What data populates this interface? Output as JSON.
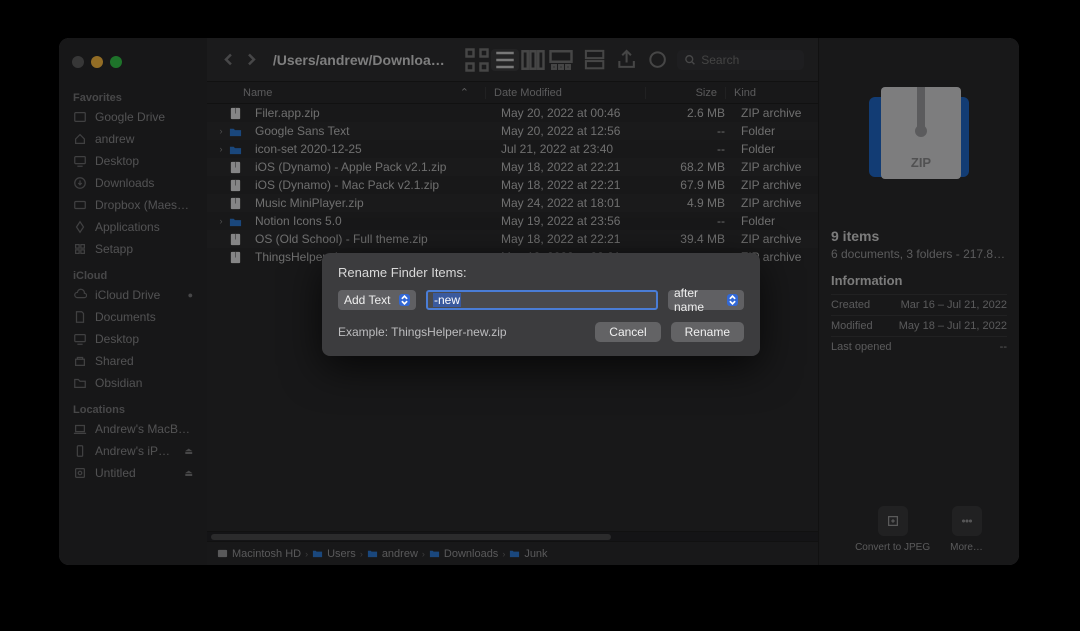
{
  "traffic": {
    "close": "close",
    "min": "minimize",
    "max": "maximize"
  },
  "sidebar": {
    "sections": [
      {
        "heading": "Favorites",
        "items": [
          {
            "label": "Google Drive",
            "icon": "drive"
          },
          {
            "label": "andrew",
            "icon": "home"
          },
          {
            "label": "Desktop",
            "icon": "desktop"
          },
          {
            "label": "Downloads",
            "icon": "downloads"
          },
          {
            "label": "Dropbox (Maes…",
            "icon": "dropbox"
          },
          {
            "label": "Applications",
            "icon": "apps"
          },
          {
            "label": "Setapp",
            "icon": "setapp"
          }
        ]
      },
      {
        "heading": "iCloud",
        "items": [
          {
            "label": "iCloud Drive",
            "icon": "cloud",
            "badge": "●"
          },
          {
            "label": "Documents",
            "icon": "doc"
          },
          {
            "label": "Desktop",
            "icon": "desktop"
          },
          {
            "label": "Shared",
            "icon": "shared"
          },
          {
            "label": "Obsidian",
            "icon": "folder"
          }
        ]
      },
      {
        "heading": "Locations",
        "items": [
          {
            "label": "Andrew's MacB…",
            "icon": "laptop"
          },
          {
            "label": "Andrew's iP…",
            "icon": "phone",
            "badge": "⏏"
          },
          {
            "label": "Untitled",
            "icon": "disk",
            "badge": "⏏"
          }
        ]
      }
    ]
  },
  "toolbar": {
    "path": "/Users/andrew/Downloads/Junk",
    "search_placeholder": "Search"
  },
  "columns": {
    "name": "Name",
    "date": "Date Modified",
    "size": "Size",
    "kind": "Kind",
    "sort": "⌃"
  },
  "files": [
    {
      "name": "Filer.app.zip",
      "date": "May 20, 2022 at 00:46",
      "size": "2.6 MB",
      "kind": "ZIP archive",
      "type": "zip"
    },
    {
      "name": "Google Sans Text",
      "date": "May 20, 2022 at 12:56",
      "size": "--",
      "kind": "Folder",
      "type": "folder",
      "expand": true
    },
    {
      "name": "icon-set 2020-12-25",
      "date": "Jul 21, 2022 at 23:40",
      "size": "--",
      "kind": "Folder",
      "type": "folder",
      "expand": true
    },
    {
      "name": "iOS (Dynamo) - Apple Pack v2.1.zip",
      "date": "May 18, 2022 at 22:21",
      "size": "68.2 MB",
      "kind": "ZIP archive",
      "type": "zip"
    },
    {
      "name": "iOS (Dynamo) - Mac Pack v2.1.zip",
      "date": "May 18, 2022 at 22:21",
      "size": "67.9 MB",
      "kind": "ZIP archive",
      "type": "zip"
    },
    {
      "name": "Music MiniPlayer.zip",
      "date": "May 24, 2022 at 18:01",
      "size": "4.9 MB",
      "kind": "ZIP archive",
      "type": "zip"
    },
    {
      "name": "Notion Icons 5.0",
      "date": "May 19, 2022 at 23:56",
      "size": "--",
      "kind": "Folder",
      "type": "folder",
      "expand": true
    },
    {
      "name": "OS (Old School) - Full theme.zip",
      "date": "May 18, 2022 at 22:21",
      "size": "39.4 MB",
      "kind": "ZIP archive",
      "type": "zip"
    },
    {
      "name": "ThingsHelper.zip",
      "date": "May 18, 2022 at 22:21",
      "size": "--",
      "kind": "ZIP archive",
      "type": "zip"
    }
  ],
  "pathbar": [
    "Macintosh HD",
    "Users",
    "andrew",
    "Downloads",
    "Junk"
  ],
  "info": {
    "title": "9 items",
    "subtitle": "6 documents, 3 folders - 217.8…",
    "heading": "Information",
    "rows": [
      {
        "k": "Created",
        "v": "Mar 16 – Jul 21, 2022"
      },
      {
        "k": "Modified",
        "v": "May 18 – Jul 21, 2022"
      },
      {
        "k": "Last opened",
        "v": "--"
      }
    ],
    "actions": [
      {
        "label": "Convert to JPEG",
        "icon": "convert"
      },
      {
        "label": "More…",
        "icon": "more"
      }
    ],
    "preview_label": "ZIP"
  },
  "dialog": {
    "title": "Rename Finder Items:",
    "mode": "Add Text",
    "text": "-new",
    "position": "after name",
    "example": "Example: ThingsHelper-new.zip",
    "cancel": "Cancel",
    "rename": "Rename"
  }
}
